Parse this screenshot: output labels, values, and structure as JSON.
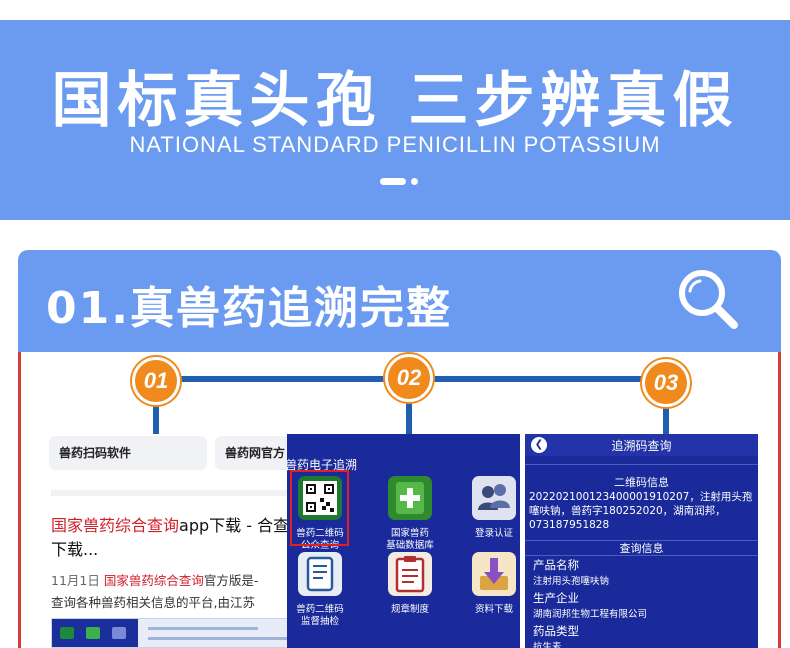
{
  "banner": {
    "title": "国标真头孢 三步辨真假",
    "subtitle": "NATIONAL STANDARD PENICILLIN POTASSIUM"
  },
  "section": {
    "title": "01.真兽药追溯完整",
    "icon": "search-icon"
  },
  "steps": [
    "01",
    "02",
    "03"
  ],
  "search_results": {
    "chip1": "兽药扫码软件",
    "chip2": "兽药网官方",
    "result_title_highlight": "国家兽药综合查询",
    "result_title_rest": "app下载 - 合查询下载...",
    "date": "11月1日",
    "meta_highlight": "国家兽药综合查询",
    "meta_rest": "官方版是-",
    "meta_line2": "查询各种兽药相关信息的平台,由江苏"
  },
  "app_grid": {
    "title": "兽药电子追溯",
    "apps": [
      {
        "label1": "兽药二维码",
        "label2": "公众查询",
        "icon": "qr-code-icon"
      },
      {
        "label1": "国家兽药",
        "label2": "基础数据库",
        "icon": "add-icon"
      },
      {
        "label1": "登录认证",
        "label2": "",
        "icon": "users-icon"
      },
      {
        "label1": "兽药二维码",
        "label2": "监督抽检",
        "icon": "document-icon"
      },
      {
        "label1": "规章制度",
        "label2": "",
        "icon": "clipboard-icon"
      },
      {
        "label1": "资料下载",
        "label2": "",
        "icon": "download-icon"
      }
    ]
  },
  "query": {
    "header": "追溯码查询",
    "qr_section": "二维码信息",
    "qr_text": "20220210012340000191020​7，注射用头孢噻呋钠，兽药字180252020，湖南润邦，073187951828",
    "info_section": "查询信息",
    "fields": [
      {
        "label": "产品名称",
        "value": "注射用头孢噻呋钠"
      },
      {
        "label": "生产企业",
        "value": "湖南润邦生物工程有限公司"
      },
      {
        "label": "药品类型",
        "value": "抗生素"
      }
    ]
  },
  "colors": {
    "banner": "#6b9bf0",
    "badge": "#f08a1c",
    "timeline": "#1f5fb0",
    "app_bg": "#1a2a9a",
    "highlight": "#d0202a"
  }
}
